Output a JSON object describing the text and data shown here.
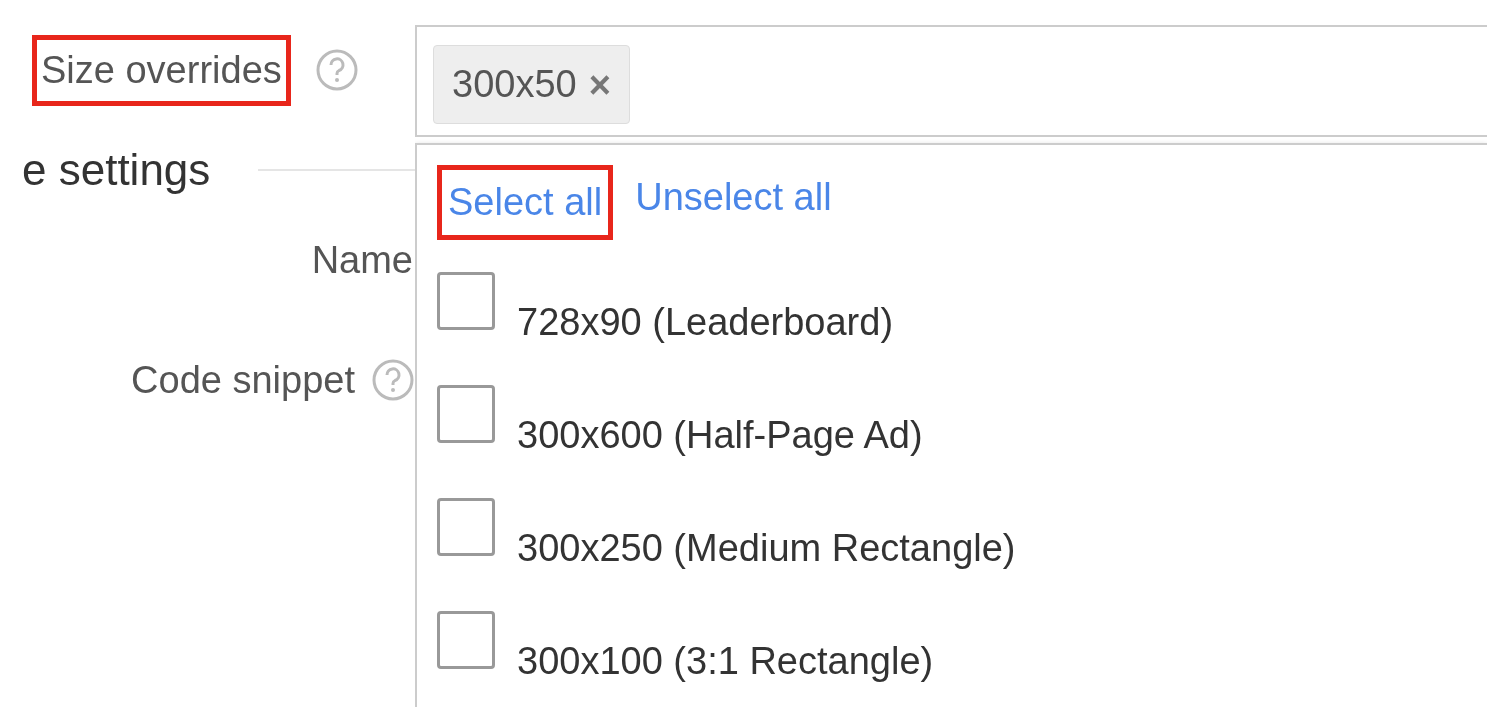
{
  "size_overrides": {
    "label": "Size overrides",
    "highlighted": true,
    "help": true,
    "chips": [
      {
        "label": "300x50",
        "remove": "×"
      }
    ]
  },
  "section": {
    "title": "e settings"
  },
  "fields": [
    {
      "label": "Name",
      "help": false
    },
    {
      "label": "Code snippet",
      "help": true
    }
  ],
  "dropdown": {
    "actions": [
      {
        "label": "Select all",
        "highlighted": true
      },
      {
        "label": "Unselect all",
        "highlighted": false
      }
    ],
    "options": [
      {
        "label": "728x90 (Leaderboard)",
        "checked": false
      },
      {
        "label": "300x600 (Half-Page Ad)",
        "checked": false
      },
      {
        "label": "300x250 (Medium Rectangle)",
        "checked": false
      },
      {
        "label": "300x100 (3:1 Rectangle)",
        "checked": false
      }
    ]
  }
}
